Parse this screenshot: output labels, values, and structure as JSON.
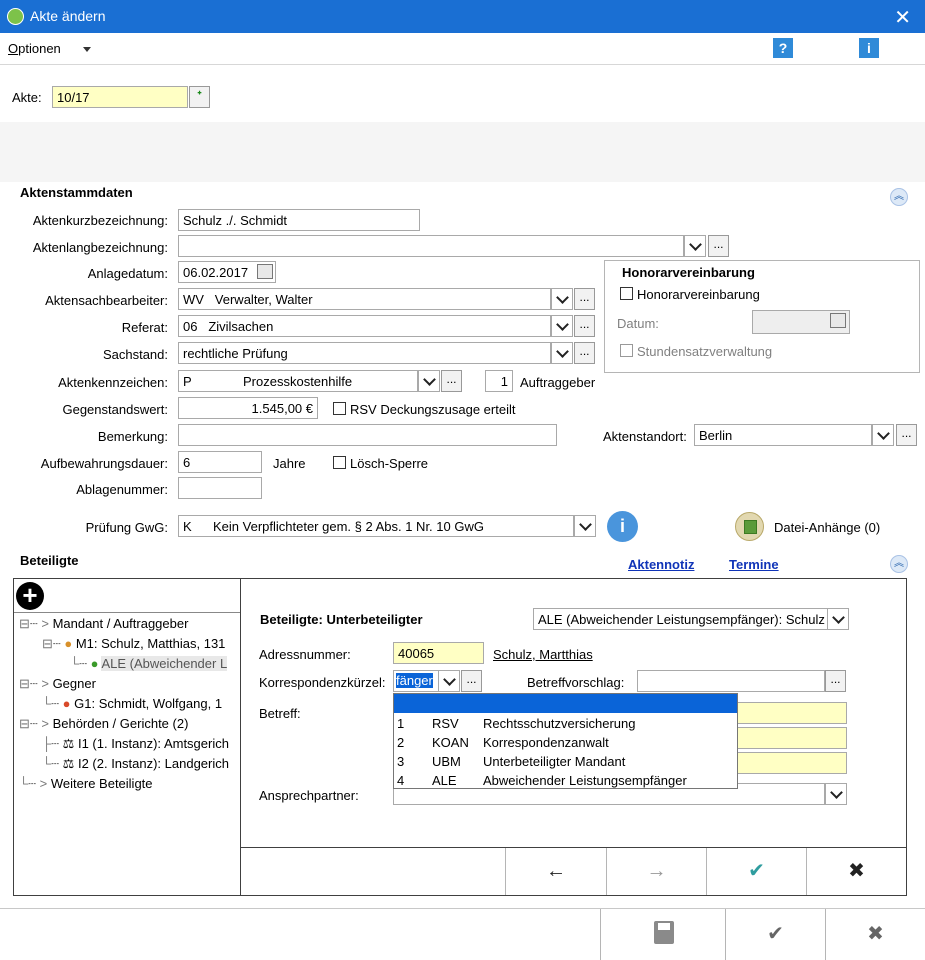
{
  "window": {
    "title": "Akte ändern",
    "close_glyph": "✕"
  },
  "menu": {
    "options_label": "Optionen",
    "help_glyph": "?",
    "info_glyph": "i"
  },
  "akte": {
    "label": "Akte:",
    "value": "10/17"
  },
  "aktenstammdaten": {
    "section_title": "Aktenstammdaten",
    "kurz_label": "Aktenkurzbezeichnung:",
    "kurz_value": "Schulz ./. Schmidt",
    "lang_label": "Aktenlangbezeichnung:",
    "lang_value": "",
    "anlage_label": "Anlagedatum:",
    "anlage_value": "06.02.2017",
    "sachbearbeiter_label": "Aktensachbearbeiter:",
    "sachbearbeiter_code": "WV",
    "sachbearbeiter_value": "Verwalter, Walter",
    "referat_label": "Referat:",
    "referat_code": "06",
    "referat_value": "Zivilsachen",
    "sachstand_label": "Sachstand:",
    "sachstand_value": "rechtliche Prüfung",
    "kennzeichen_label": "Aktenkennzeichen:",
    "kennzeichen_code": "P",
    "kennzeichen_value": "Prozesskostenhilfe",
    "auftraggeber_count": "1",
    "auftraggeber_label": "Auftraggeber",
    "gegenstand_label": "Gegenstandswert:",
    "gegenstand_value": "1.545,00 €",
    "rsv_label": "RSV Deckungszusage erteilt",
    "bemerkung_label": "Bemerkung:",
    "bemerkung_value": "",
    "standort_label": "Aktenstandort:",
    "standort_value": "Berlin",
    "aufbewahrung_label": "Aufbewahrungsdauer:",
    "aufbewahrung_value": "6",
    "jahre_label": "Jahre",
    "loesch_label": "Lösch-Sperre",
    "ablage_label": "Ablagenummer:",
    "ablage_value": "",
    "gwg_label": "Prüfung GwG:",
    "gwg_code": "K",
    "gwg_value": "Kein Verpflichteter gem. § 2 Abs. 1 Nr. 10 GwG",
    "datei_label": "Datei-Anhänge (0)"
  },
  "honorar": {
    "group_title": "Honorarvereinbarung",
    "check_label": "Honorarvereinbarung",
    "datum_label": "Datum:",
    "stundensatz_label": "Stundensatzverwaltung"
  },
  "beteiligte": {
    "section_title": "Beteiligte",
    "aktennotiz_link": "Aktennotiz",
    "termine_link": "Termine",
    "tree": [
      "Mandant / Auftraggeber",
      "M1: Schulz, Matthias, 131",
      "ALE (Abweichender L",
      "Gegner",
      "G1: Schmidt, Wolfgang, 1",
      "Behörden / Gerichte (2)",
      "I1 (1. Instanz): Amtsgerich",
      "I2 (2. Instanz): Landgerich",
      "Weitere Beteiligte"
    ],
    "detail_title": "Beteiligte: Unterbeteiligter",
    "role_select": "ALE (Abweichender Leistungsempfänger): Schulz",
    "adress_label": "Adressnummer:",
    "adress_value": "40065",
    "adress_name": "Schulz, Martthias",
    "korr_label": "Korrespondenzkürzel:",
    "korr_value": "fänger",
    "betreffvorschlag_label": "Betreffvorschlag:",
    "betreff_label": "Betreff:",
    "ansprech_label": "Ansprechpartner:"
  },
  "dropdown_popup": {
    "rows": [
      {
        "num": "1",
        "code": "RSV",
        "text": "Rechtsschutzversicherung"
      },
      {
        "num": "2",
        "code": "KOAN",
        "text": "Korrespondenzanwalt"
      },
      {
        "num": "3",
        "code": "UBM",
        "text": "Unterbeteiligter Mandant"
      },
      {
        "num": "4",
        "code": "ALE",
        "text": "Abweichender Leistungsempfänger"
      }
    ]
  },
  "inner_buttons": {
    "back": "←",
    "forward": "→",
    "ok": "✔",
    "cancel": "✖"
  },
  "bottom_buttons": {
    "save_icon": "save-icon",
    "ok": "✔",
    "cancel": "✖"
  },
  "colors": {
    "titlebar": "#1a6fd3",
    "yellow_field": "#ffffc4",
    "selection": "#0a64d8",
    "link": "#1034b8"
  }
}
